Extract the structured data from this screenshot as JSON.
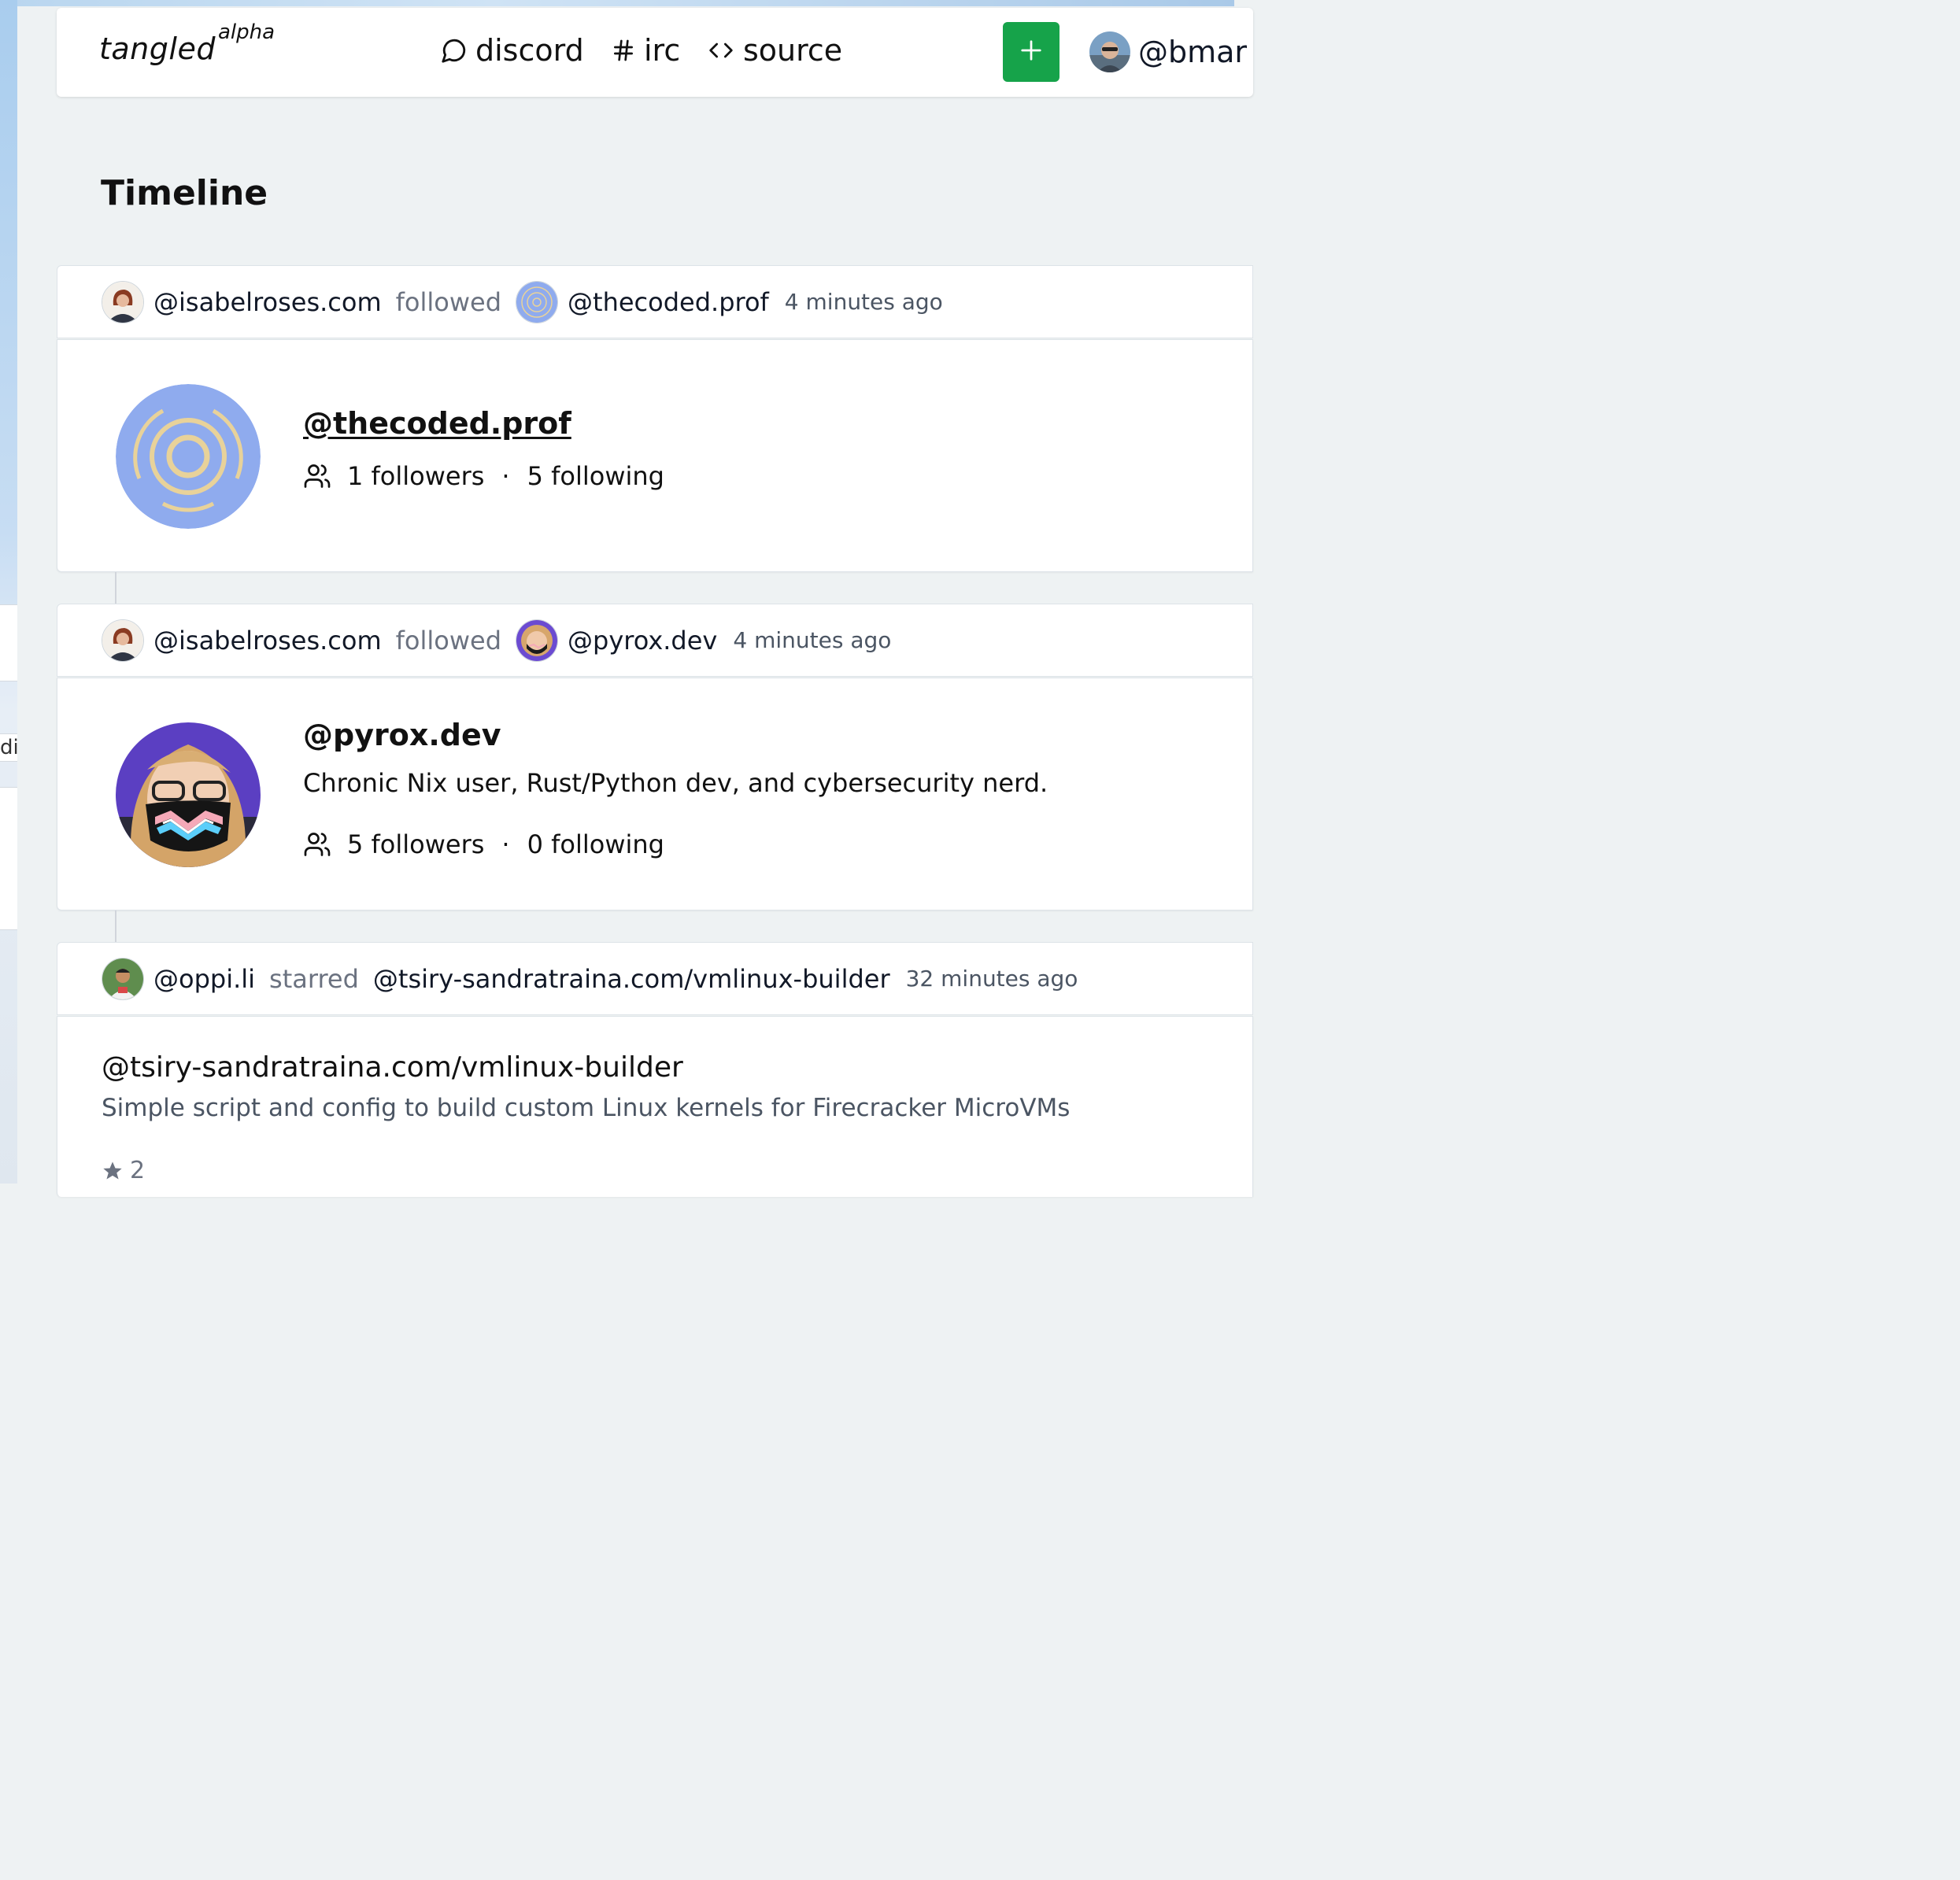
{
  "navbar": {
    "logo": "tangled",
    "logo_badge": "alpha",
    "links": [
      {
        "label": "discord",
        "icon": "message-circle-icon"
      },
      {
        "label": "irc",
        "icon": "hash-icon"
      },
      {
        "label": "source",
        "icon": "code-icon"
      }
    ],
    "new_button_icon": "plus-icon",
    "user_handle": "@bmar"
  },
  "page": {
    "title": "Timeline"
  },
  "timeline": [
    {
      "actor": "@isabelroses.com",
      "action": "followed",
      "target": "@thecoded.prof",
      "time": "4 minutes ago",
      "profile": {
        "handle": "@thecoded.prof",
        "followers": "1 followers",
        "following": "5 following"
      }
    },
    {
      "actor": "@isabelroses.com",
      "action": "followed",
      "target": "@pyrox.dev",
      "time": "4 minutes ago",
      "profile": {
        "handle": "@pyrox.dev",
        "bio": "Chronic Nix user, Rust/Python dev, and cybersecurity nerd.",
        "followers": "5 followers",
        "following": "0 following"
      }
    },
    {
      "actor": "@oppi.li",
      "action": "starred",
      "target": "@tsiry-sandratraina.com/vmlinux-builder",
      "time": "32 minutes ago",
      "repo": {
        "name": "@tsiry-sandratraina.com/vmlinux-builder",
        "description": "Simple script and config to build custom Linux kernels for Firecracker MicroVMs",
        "stars": "2"
      }
    }
  ],
  "background_fragment": "di",
  "colors": {
    "accent_green": "#16a34a",
    "avatar_blue": "#8fabee",
    "avatar_ring": "#e8d29a"
  },
  "separator": "·"
}
